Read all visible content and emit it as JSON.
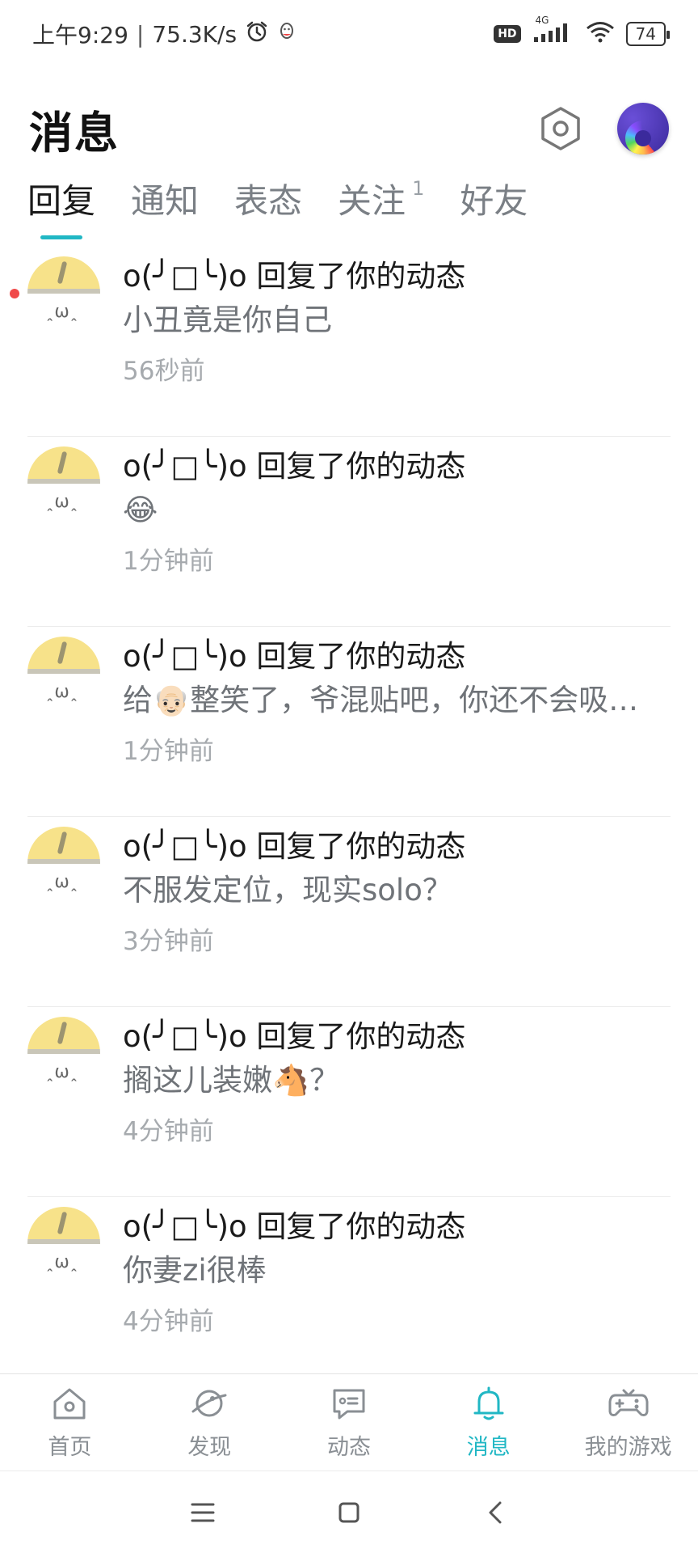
{
  "status_bar": {
    "time": "上午9:29",
    "separator": "|",
    "net_speed": "75.3K/s",
    "network_type": "4G",
    "hd_label": "HD",
    "battery": "74"
  },
  "header": {
    "title": "消息",
    "settings_icon": "settings-hex-icon",
    "avatar_icon": "rainbow-avatar"
  },
  "tabs": [
    {
      "label": "回复",
      "active": true,
      "count": ""
    },
    {
      "label": "通知",
      "active": false,
      "count": ""
    },
    {
      "label": "表态",
      "active": false,
      "count": ""
    },
    {
      "label": "关注",
      "active": false,
      "count": "1"
    },
    {
      "label": "好友",
      "active": false,
      "count": ""
    }
  ],
  "messages": [
    {
      "title": "o(╯□╰)o 回复了你的动态",
      "content": "小丑竟是你自己",
      "time": "56秒前",
      "unread": true
    },
    {
      "title": "o(╯□╰)o 回复了你的动态",
      "content": "😂",
      "time": "1分钟前",
      "unread": false
    },
    {
      "title": "o(╯□╰)o 回复了你的动态",
      "content": "给👴🏻整笑了，爷混贴吧，你还不会吸…",
      "time": "1分钟前",
      "unread": false
    },
    {
      "title": "o(╯□╰)o 回复了你的动态",
      "content": "不服发定位，现实solo？",
      "time": "3分钟前",
      "unread": false
    },
    {
      "title": "o(╯□╰)o 回复了你的动态",
      "content": "搁这儿装嫩🐴？",
      "time": "4分钟前",
      "unread": false
    },
    {
      "title": "o(╯□╰)o 回复了你的动态",
      "content": "你妻zi很棒",
      "time": "4分钟前",
      "unread": false
    }
  ],
  "avatar_face": "ꞈωꞈ",
  "bottom_nav": [
    {
      "label": "首页",
      "icon": "home-icon",
      "active": false
    },
    {
      "label": "发现",
      "icon": "planet-icon",
      "active": false
    },
    {
      "label": "动态",
      "icon": "chat-icon",
      "active": false
    },
    {
      "label": "消息",
      "icon": "bell-icon",
      "active": true
    },
    {
      "label": "我的游戏",
      "icon": "gamepad-icon",
      "active": false
    }
  ],
  "colors": {
    "accent": "#21b7c4",
    "unread_dot": "#f04a4a",
    "muted_text": "#6f7378",
    "time_text": "#a6aaae"
  }
}
